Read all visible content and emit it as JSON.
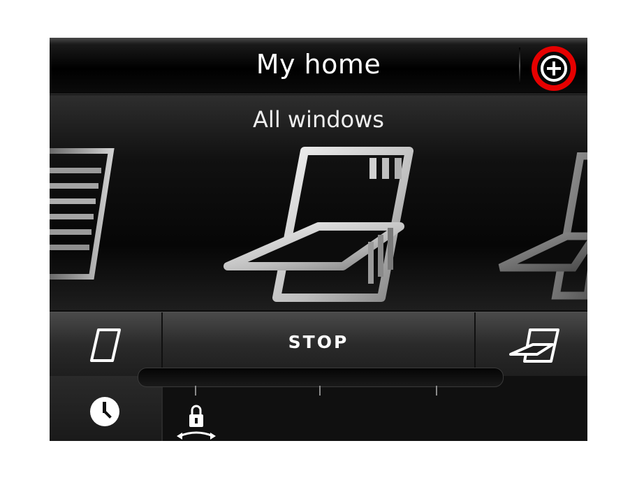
{
  "header": {
    "title": "My home"
  },
  "carousel": {
    "group_name": "All windows"
  },
  "controls": {
    "stop_label": "STOP"
  },
  "colors": {
    "highlight_ring": "#e60000",
    "background": "#0c0c0c",
    "icon": "#d8d8d8"
  },
  "icons": {
    "add": "plus-circle-icon",
    "window_closed": "window-closed-icon",
    "window_open": "window-open-icon",
    "timer": "clock-icon",
    "lock": "lock-position-icon"
  }
}
